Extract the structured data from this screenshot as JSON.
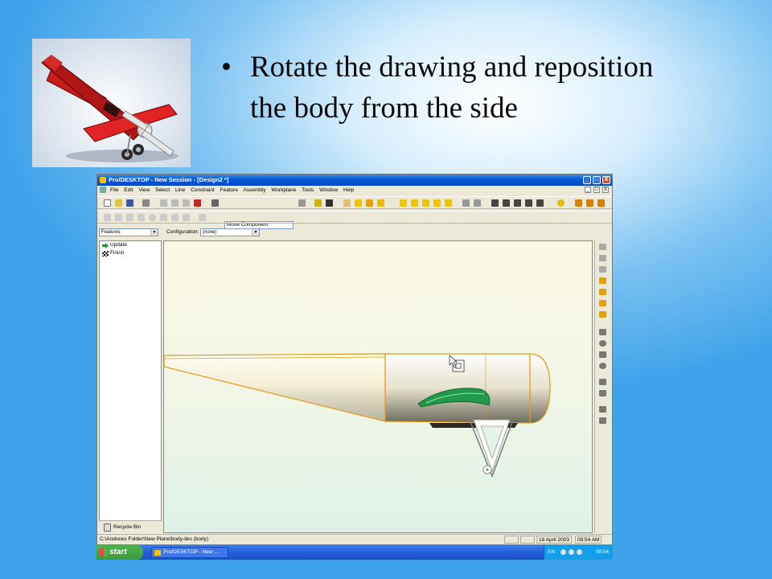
{
  "slide": {
    "bullet": "•",
    "text": "Rotate the drawing and reposition the body from the side"
  },
  "window": {
    "title": "Pro/DESKTOP - New Session - [Design2 *]",
    "controls": [
      "_",
      "□",
      "X"
    ],
    "menu": [
      "File",
      "Edit",
      "View",
      "Select",
      "Line",
      "Constraint",
      "Feature",
      "Assembly",
      "Workplane",
      "Tools",
      "Window",
      "Help"
    ],
    "command_combo": "Move Component",
    "features_select": "Features",
    "configuration_label": "Configuration:",
    "configuration_value": "(none)"
  },
  "tree": {
    "items": [
      {
        "label": "Update",
        "icon": "green-arrow-icon"
      },
      {
        "label": "Finish",
        "icon": "checkered-flag-icon"
      }
    ],
    "recycle_bin": "Recycle Bin"
  },
  "statusbar": {
    "path": "C:\\Andrews Folder\\New Plane\\body.des (body)",
    "date": "18 April 2003",
    "time": "08:54 AM"
  },
  "taskbar": {
    "start": "start",
    "task": "Pro/DESKTOP - New ...",
    "lang": "EN",
    "clock": "08:54"
  },
  "colors": {
    "slide_bg": "#3fa3e9",
    "xp_title": "#0a5bd8",
    "model_edge": "#e39a1c",
    "cockpit": "#1f9a4a"
  }
}
